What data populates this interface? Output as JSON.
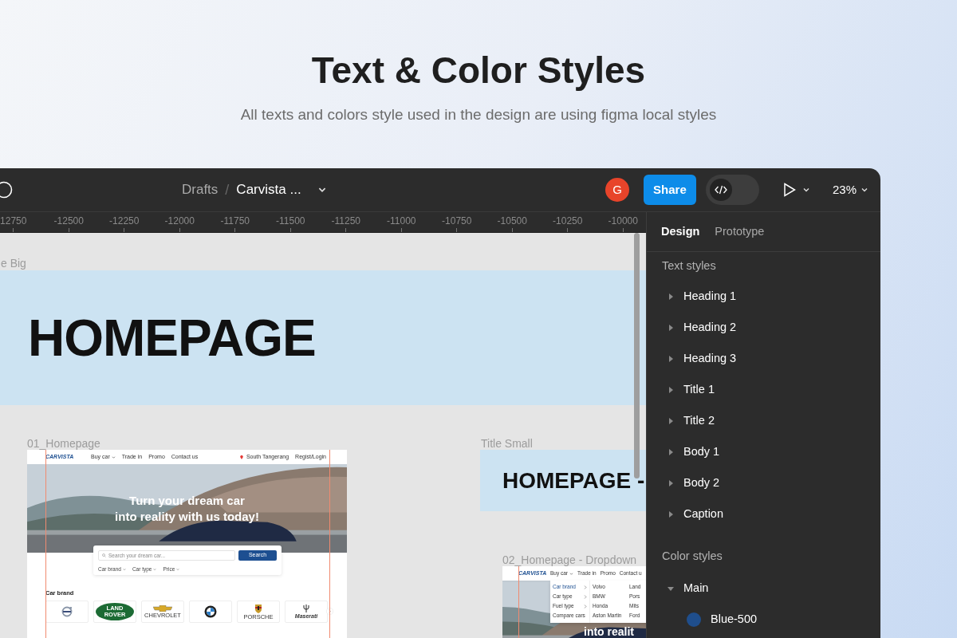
{
  "page": {
    "title": "Text & Color Styles",
    "subtitle": "All texts and colors style used in the design are using figma local styles"
  },
  "toolbar": {
    "breadcrumb": [
      "Drafts",
      "Carvista ..."
    ],
    "separator": "/",
    "avatar": "G",
    "share": "Share",
    "dev_mode_on": false,
    "zoom": "23%"
  },
  "ruler": [
    "12750",
    "-12500",
    "-12250",
    "-12000",
    "-11750",
    "-11500",
    "-11250",
    "-11000",
    "-10750",
    "-10500",
    "-10250",
    "-10000"
  ],
  "canvas": {
    "sections": [
      {
        "label": "e Big",
        "heading": "HOMEPAGE",
        "kind": "big"
      },
      {
        "label": "Title Small",
        "heading": "HOMEPAGE -",
        "kind": "small"
      }
    ],
    "frames": [
      {
        "label": "01_Homepage",
        "kind": "homepage",
        "logo": "CARVISTA",
        "nav": [
          {
            "label": "Buy car",
            "dropdown": true
          },
          {
            "label": "Trade in",
            "dropdown": false
          },
          {
            "label": "Promo",
            "dropdown": false
          },
          {
            "label": "Contact us",
            "dropdown": false
          }
        ],
        "location": "South Tangerang",
        "login": "Regist/Login",
        "hero": [
          "Turn your dream car",
          "into reality with us today!"
        ],
        "search": {
          "placeholder": "Search your dream car...",
          "button": "Search",
          "filters": [
            "Car brand",
            "Car type",
            "Price"
          ]
        },
        "brands_title": "Car brand",
        "brands": [
          {
            "kind": "volvo"
          },
          {
            "kind": "landrover",
            "text": "LAND ROVER"
          },
          {
            "kind": "chevrolet",
            "text": "CHEVROLET"
          },
          {
            "kind": "bmw"
          },
          {
            "kind": "porsche",
            "text": "PORSCHE"
          },
          {
            "kind": "maserati",
            "text": "Maserati"
          }
        ]
      },
      {
        "label": "02_Homepage - Dropdown",
        "kind": "dropdown",
        "logo": "CARVISTA",
        "nav": [
          {
            "label": "Buy car",
            "dropdown": true
          },
          {
            "label": "Trade in",
            "dropdown": false
          },
          {
            "label": "Promo",
            "dropdown": false
          },
          {
            "label": "Contact u",
            "dropdown": false
          }
        ],
        "menu": [
          {
            "label": "Car brand",
            "selected": true,
            "submenu": true
          },
          {
            "label": "Car type",
            "selected": false,
            "submenu": true
          },
          {
            "label": "Fuel type",
            "selected": false,
            "submenu": true
          },
          {
            "label": "Compare cars",
            "selected": false,
            "submenu": false
          }
        ],
        "submenu_columns": [
          [
            "Volvo",
            "BMW",
            "Honda",
            "Aston Martin"
          ],
          [
            "Land",
            "Pors",
            "Mits",
            "Ford"
          ]
        ],
        "hero": [
          "into realit"
        ]
      }
    ]
  },
  "panel": {
    "tabs": [
      {
        "label": "Design",
        "selected": true
      },
      {
        "label": "Prototype",
        "selected": false
      }
    ],
    "text_styles": {
      "title": "Text styles",
      "items": [
        {
          "name": "Heading 1",
          "expanded": false
        },
        {
          "name": "Heading 2",
          "expanded": false
        },
        {
          "name": "Heading 3",
          "expanded": false
        },
        {
          "name": "Title 1",
          "expanded": false
        },
        {
          "name": "Title 2",
          "expanded": false
        },
        {
          "name": "Body 1",
          "expanded": false
        },
        {
          "name": "Body 2",
          "expanded": false
        },
        {
          "name": "Caption",
          "expanded": false
        }
      ]
    },
    "color_styles": {
      "title": "Color styles",
      "groups": [
        {
          "name": "Main",
          "expanded": true,
          "children": [
            {
              "name": "Blue-500",
              "color": "#1f4e8c"
            }
          ]
        }
      ]
    }
  }
}
